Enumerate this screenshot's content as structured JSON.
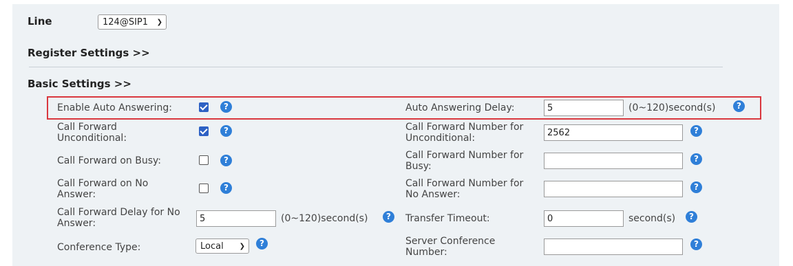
{
  "line": {
    "label": "Line",
    "value": "124@SIP1"
  },
  "register_settings": "Register Settings >>",
  "basic_settings": "Basic Settings >>",
  "left": {
    "enable_auto_answering": {
      "label": "Enable Auto Answering:",
      "checked": true
    },
    "call_forward_unconditional": {
      "label1": "Call Forward",
      "label2": "Unconditional:",
      "checked": true
    },
    "call_forward_busy": {
      "label": "Call Forward on Busy:",
      "checked": false
    },
    "call_forward_no_answer": {
      "label1": "Call Forward on No",
      "label2": "Answer:",
      "checked": false
    },
    "call_forward_delay": {
      "label1": "Call Forward Delay for No",
      "label2": "Answer:",
      "value": "5",
      "unit": "(0~120)second(s)"
    },
    "conference_type": {
      "label": "Conference Type:",
      "value": "Local"
    }
  },
  "right": {
    "auto_answering_delay": {
      "label": "Auto Answering Delay:",
      "value": "5",
      "unit": "(0~120)second(s)"
    },
    "cf_number_unconditional": {
      "label1": "Call Forward Number for",
      "label2": "Unconditional:",
      "value": "2562"
    },
    "cf_number_busy": {
      "label1": "Call Forward Number for",
      "label2": "Busy:",
      "value": ""
    },
    "cf_number_no_answer": {
      "label1": "Call Forward Number for",
      "label2": "No Answer:",
      "value": ""
    },
    "transfer_timeout": {
      "label": "Transfer Timeout:",
      "value": "0",
      "unit": "second(s)"
    },
    "server_conference_number": {
      "label1": "Server Conference",
      "label2": "Number:",
      "value": ""
    }
  },
  "help_glyph": "?",
  "colors": {
    "panel_bg": "#eef2f5",
    "checkbox_blue": "#2e61c4",
    "help_blue": "#2f7fd8",
    "highlight_red": "#d9373e"
  }
}
